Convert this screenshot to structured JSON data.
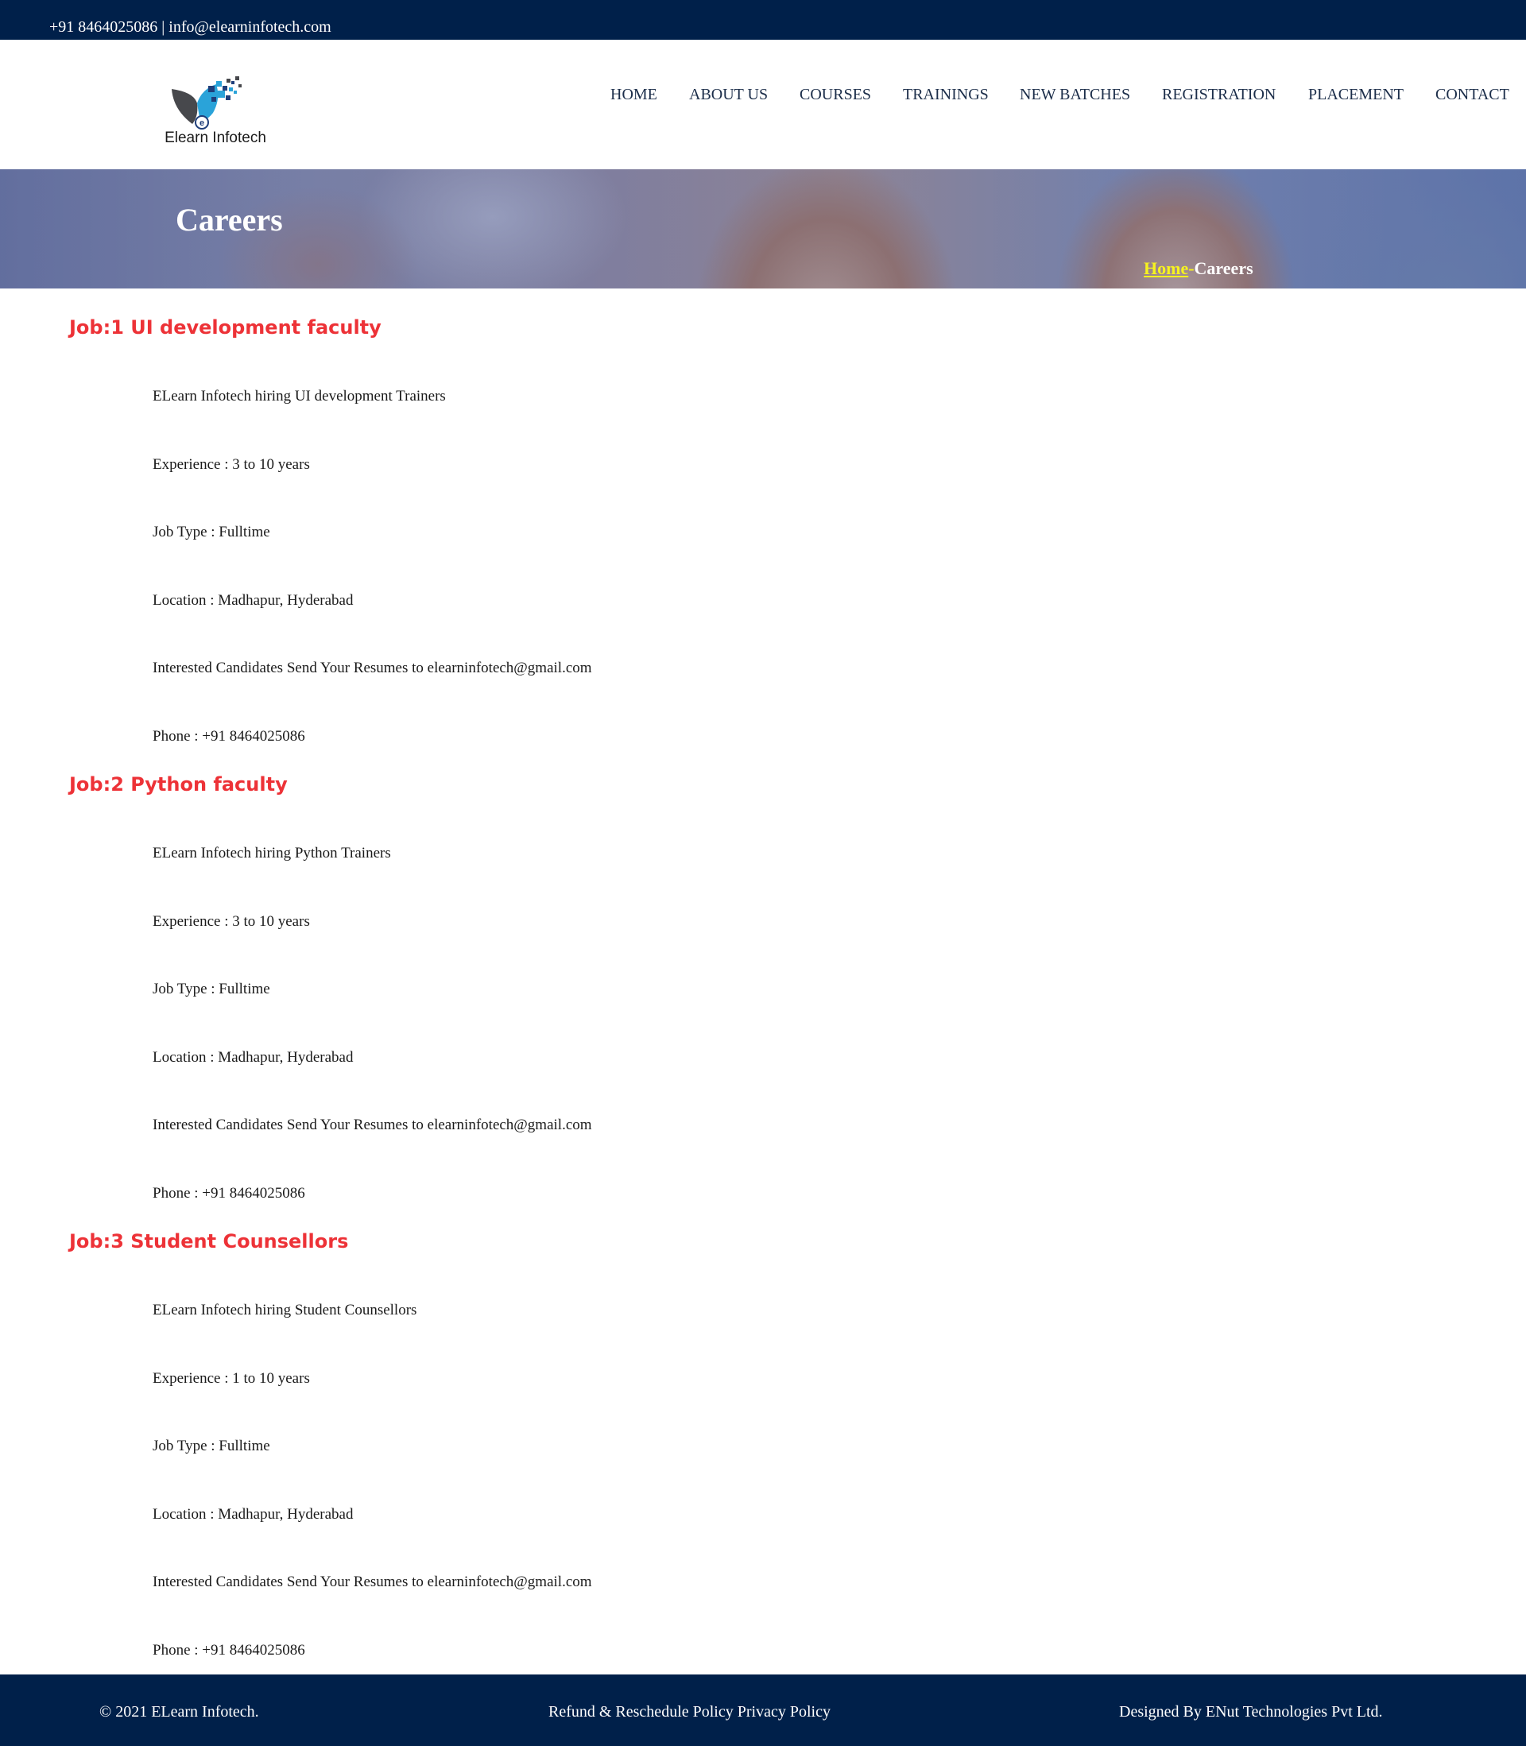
{
  "topbar": {
    "contact": "+91 8464025086 | info@elearninfotech.com"
  },
  "logo": {
    "name": "Elearn Infotech",
    "icon_letter": "e"
  },
  "nav": [
    "HOME",
    "ABOUT US",
    "COURSES",
    "TRAININGS",
    "NEW BATCHES",
    "REGISTRATION",
    "PLACEMENT",
    "CONTACT"
  ],
  "banner": {
    "title": "Careers",
    "breadcrumb_home": "Home",
    "breadcrumb_separator": "-",
    "breadcrumb_current": "Careers"
  },
  "jobs": [
    {
      "title": "Job:1 UI development faculty",
      "lines": [
        "ELearn Infotech hiring UI development Trainers",
        "Experience : 3 to 10 years",
        "Job Type : Fulltime",
        "Location : Madhapur, Hyderabad",
        "Interested Candidates Send Your Resumes to elearninfotech@gmail.com",
        "Phone : +91 8464025086"
      ]
    },
    {
      "title": "Job:2 Python faculty",
      "lines": [
        "ELearn Infotech hiring Python Trainers",
        "Experience : 3 to 10 years",
        "Job Type : Fulltime",
        "Location : Madhapur, Hyderabad",
        "Interested Candidates Send Your Resumes to elearninfotech@gmail.com",
        "Phone : +91 8464025086"
      ]
    },
    {
      "title": "Job:3 Student Counsellors",
      "lines": [
        "ELearn Infotech hiring Student Counsellors",
        "Experience : 1 to 10 years",
        "Job Type : Fulltime",
        "Location : Madhapur, Hyderabad",
        "Interested Candidates Send Your Resumes to elearninfotech@gmail.com",
        "Phone : +91 8464025086"
      ]
    }
  ],
  "footer": {
    "copyright": "© 2021 ELearn Infotech.",
    "policies": "Refund & Reschedule Policy Privacy Policy",
    "designer": "Designed By ENut Technologies Pvt Ltd."
  },
  "colors": {
    "navy": "#00204a",
    "job_title_red": "#ed3237",
    "breadcrumb_yellow": "#f7f31f",
    "nav_text": "#1c2e4a"
  }
}
